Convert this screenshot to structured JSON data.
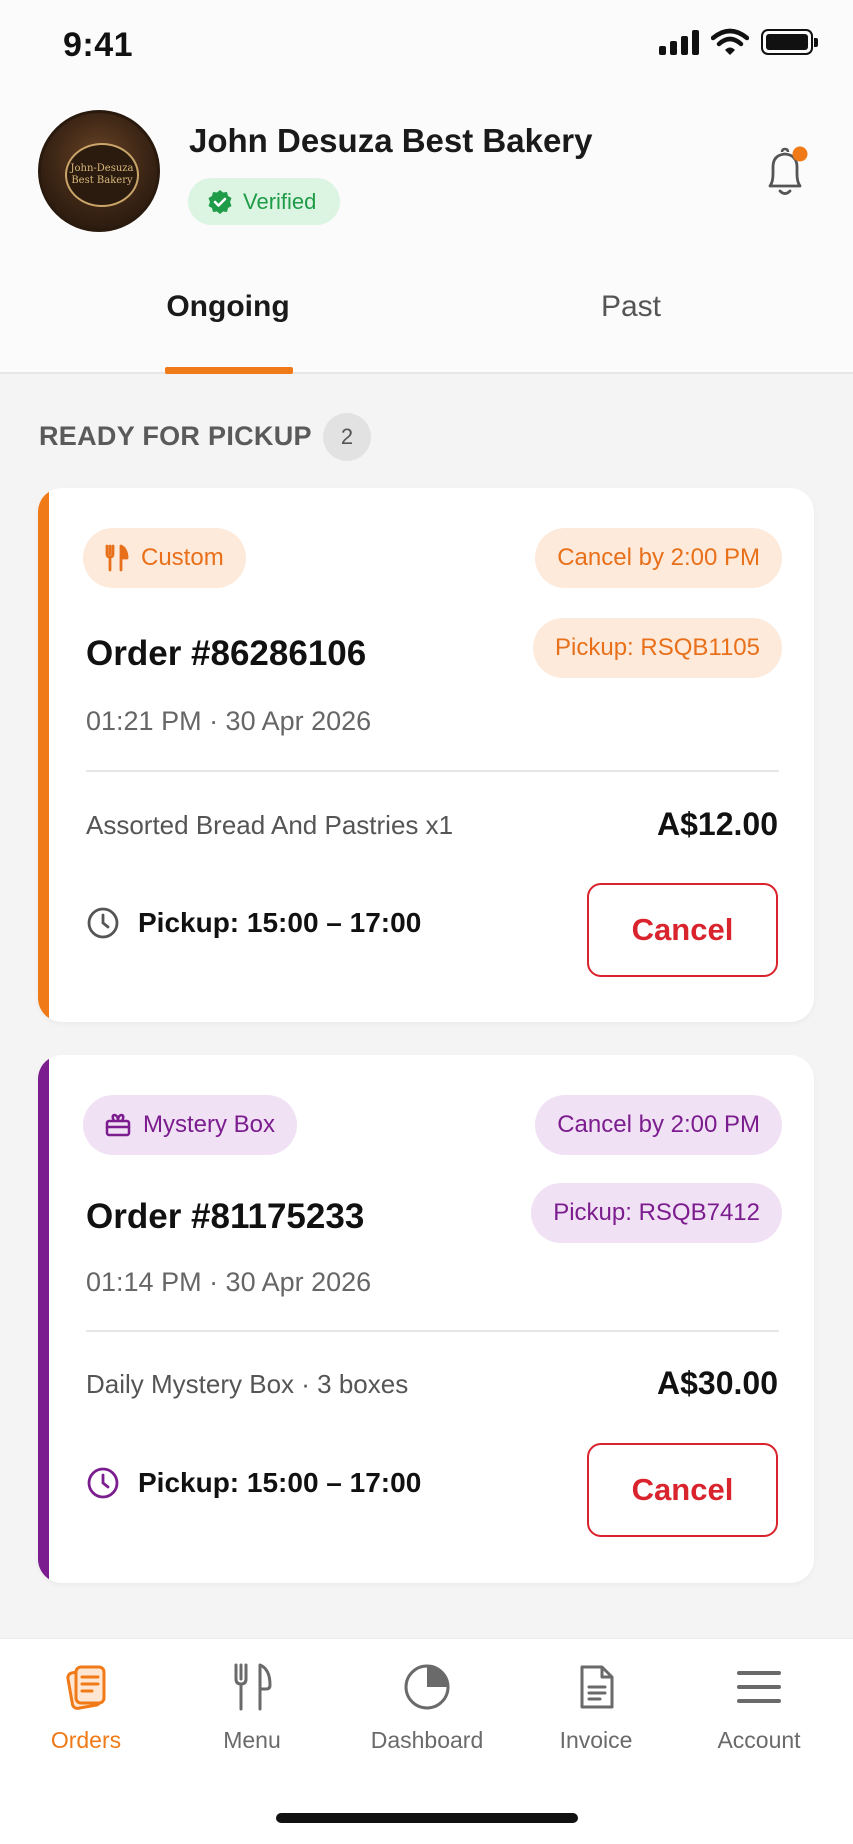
{
  "status_bar": {
    "time": "9:41"
  },
  "header": {
    "shop_name": "John Desuza Best Bakery",
    "verified_label": "Verified",
    "avatar_sign": [
      "John-Desuza",
      "Best Bakery"
    ]
  },
  "tabs": [
    {
      "label": "Ongoing",
      "active": true
    },
    {
      "label": "Past",
      "active": false
    }
  ],
  "section": {
    "title": "READY FOR PICKUP",
    "count": "2"
  },
  "orders": [
    {
      "type_label": "Custom",
      "type_icon": "fork-knife-icon",
      "accent": "#f07a17",
      "cancel_by": "Cancel by 2:00 PM",
      "pickup_code": "Pickup: RSQB1105",
      "order_id": "Order #86286106",
      "time": "01:21 PM · 30 Apr 2026",
      "item": "Assorted Bread And Pastries x1",
      "price": "A$12.00",
      "pickup_window": "Pickup: 15:00 – 17:00",
      "cancel_label": "Cancel"
    },
    {
      "type_label": "Mystery Box",
      "type_icon": "gift-box-icon",
      "accent": "#7b1d8e",
      "cancel_by": "Cancel by 2:00 PM",
      "pickup_code": "Pickup: RSQB7412",
      "order_id": "Order #81175233",
      "time": "01:14 PM · 30 Apr 2026",
      "item": "Daily Mystery Box · 3 boxes",
      "price": "A$30.00",
      "pickup_window": "Pickup: 15:00 – 17:00",
      "cancel_label": "Cancel"
    }
  ],
  "bottom_nav": [
    {
      "label": "Orders",
      "icon": "orders-icon",
      "active": true
    },
    {
      "label": "Menu",
      "icon": "fork-knife-icon",
      "active": false
    },
    {
      "label": "Dashboard",
      "icon": "pie-chart-icon",
      "active": false
    },
    {
      "label": "Invoice",
      "icon": "document-icon",
      "active": false
    },
    {
      "label": "Account",
      "icon": "hamburger-menu-icon",
      "active": false
    }
  ],
  "colors": {
    "accent_orange": "#f07a17",
    "accent_purple": "#7b1d8e",
    "cancel_red": "#d9232d",
    "verified_green": "#1f9c47",
    "custom_pill_bg": "#fdeadb",
    "mystery_pill_bg": "#f1e1f4"
  }
}
